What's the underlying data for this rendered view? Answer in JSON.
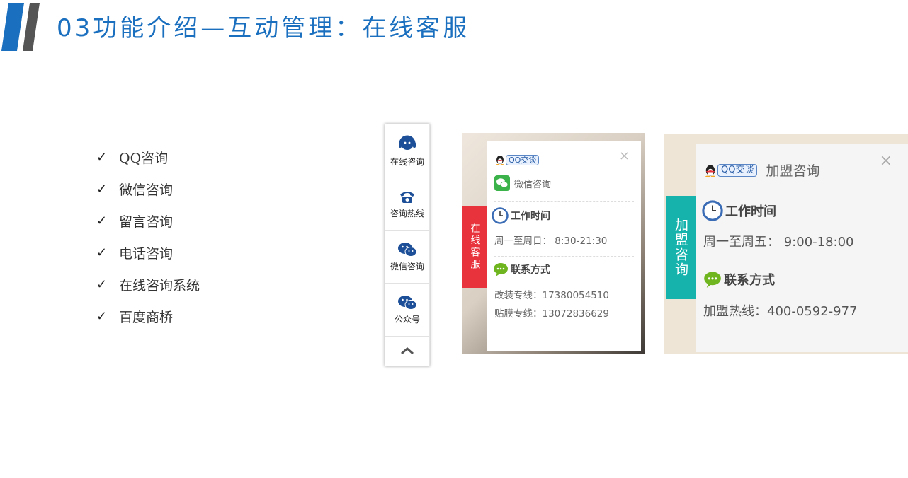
{
  "title": "03功能介绍—互动管理：在线客服",
  "checklist": [
    "QQ咨询",
    "微信咨询",
    "留言咨询",
    "电话咨询",
    "在线咨询系统",
    "百度商桥"
  ],
  "check_mark": "✓",
  "vertical_widget": {
    "items": [
      {
        "label": "在线咨询",
        "icon": "headset-icon"
      },
      {
        "label": "咨询热线",
        "icon": "phone-icon"
      },
      {
        "label": "微信咨询",
        "icon": "wechat-icon"
      },
      {
        "label": "公众号",
        "icon": "wechat-icon"
      }
    ],
    "top_icon": "chevron-up-icon"
  },
  "panel1": {
    "tab_label": "在线客服",
    "qq_badge": "QQ交谈",
    "wechat_label": "微信咨询",
    "work_time_heading": "工作时间",
    "work_time": "周一至周日： 8:30-21:30",
    "contact_heading": "联系方式",
    "contacts": [
      "改装专线：17380054510",
      "贴膜专线：13072836629"
    ],
    "close": "×"
  },
  "panel2": {
    "tab_label": "加盟咨询",
    "qq_badge": "QQ交谈",
    "qq_label": "加盟咨询",
    "work_time_heading": "工作时间",
    "work_time": "周一至周五： 9:00-18:00",
    "contact_heading": "联系方式",
    "contact": "加盟热线：400-0592-977",
    "close": "×"
  },
  "colors": {
    "title": "#1a6fbf",
    "logo_blue": "#1a6fbf",
    "logo_gray": "#555555",
    "red_tab": "#e8323c",
    "teal_tab": "#16b3ac",
    "icon_blue": "#1c4f97"
  }
}
